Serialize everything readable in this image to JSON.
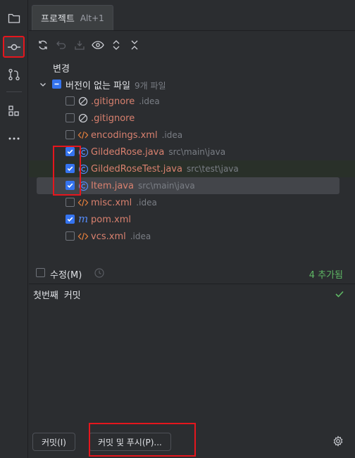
{
  "tool_window": {
    "tab_name": "프로젝트",
    "tab_shortcut": "Alt+1"
  },
  "stripe": {
    "items": [
      "folder-icon",
      "commit-icon",
      "pull-requests-icon",
      "structure-icon",
      "more-icon"
    ]
  },
  "toolbar": {
    "buttons": [
      "refresh-icon",
      "rollback-icon",
      "shelve-icon",
      "view-options-icon",
      "expand-all-icon",
      "collapse-all-icon"
    ]
  },
  "tree": {
    "root_label": "변경",
    "group": {
      "label": "버전이 없는 파일",
      "count": "9개 파일"
    },
    "files": [
      {
        "name": ".gitignore",
        "path": ".idea",
        "checked": false,
        "icon": "ignore-icon"
      },
      {
        "name": ".gitignore",
        "path": "",
        "checked": false,
        "icon": "ignore-icon"
      },
      {
        "name": "encodings.xml",
        "path": ".idea",
        "checked": false,
        "icon": "xml-icon"
      },
      {
        "name": "GildedRose.java",
        "path": "src\\main\\java",
        "checked": true,
        "icon": "java-class-icon"
      },
      {
        "name": "GildedRoseTest.java",
        "path": "src\\test\\java",
        "checked": true,
        "icon": "java-class-icon"
      },
      {
        "name": "Item.java",
        "path": "src\\main\\java",
        "checked": true,
        "icon": "java-class-icon"
      },
      {
        "name": "misc.xml",
        "path": ".idea",
        "checked": false,
        "icon": "xml-icon"
      },
      {
        "name": "pom.xml",
        "path": "",
        "checked": true,
        "icon": "maven-icon"
      },
      {
        "name": "vcs.xml",
        "path": ".idea",
        "checked": false,
        "icon": "xml-icon"
      }
    ]
  },
  "amend": {
    "label": "수정(M)",
    "added": "4 추가됨"
  },
  "commit_message": {
    "text": "첫번째 커밋"
  },
  "actions": {
    "commit_label": "커밋(I)",
    "commit_push_label": "커밋 및 푸시(P)..."
  },
  "colors": {
    "accent": "#3574f0",
    "unversioned": "#d9816f",
    "added": "#5fb865",
    "highlight": "#e5161d"
  }
}
